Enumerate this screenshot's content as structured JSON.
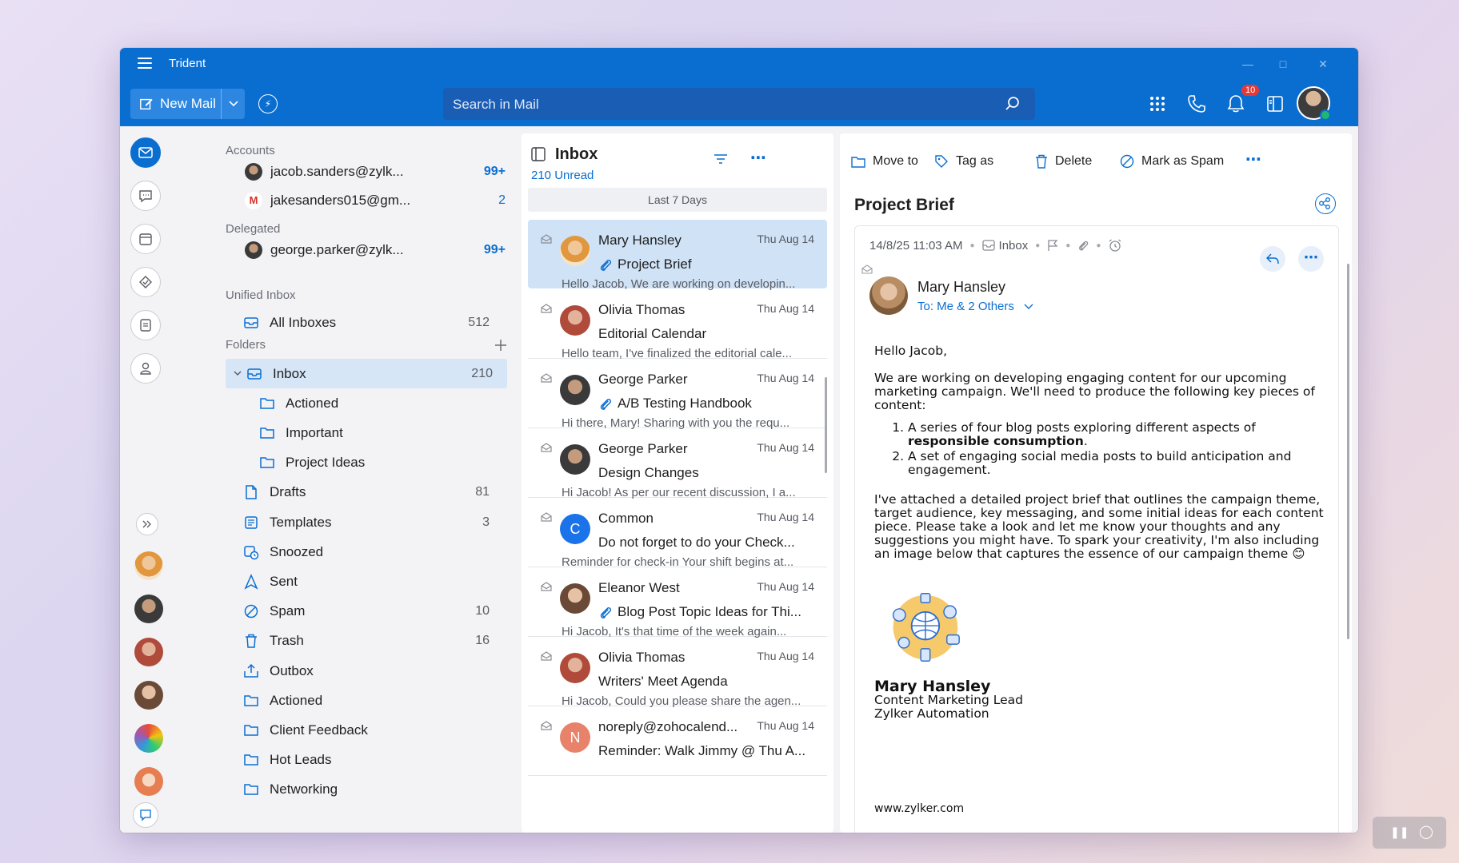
{
  "app": {
    "title": "Trident"
  },
  "toolbar": {
    "new_mail": "New Mail",
    "search_placeholder": "Search in Mail",
    "notification_count": "10"
  },
  "sidebar": {
    "accounts_label": "Accounts",
    "accounts": [
      {
        "name": "jacob.sanders@zylk...",
        "count": "99+"
      },
      {
        "name": "jakesanders015@gm...",
        "count": "2"
      }
    ],
    "delegated_label": "Delegated",
    "delegated": [
      {
        "name": "george.parker@zylk...",
        "count": "99+"
      }
    ],
    "unified_label": "Unified Inbox",
    "all_inboxes": {
      "name": "All Inboxes",
      "count": "512"
    },
    "folders_label": "Folders",
    "folders": [
      {
        "name": "Inbox",
        "count": "210"
      },
      {
        "name": "Actioned",
        "count": ""
      },
      {
        "name": "Important",
        "count": ""
      },
      {
        "name": "Project Ideas",
        "count": ""
      },
      {
        "name": "Drafts",
        "count": "81"
      },
      {
        "name": "Templates",
        "count": "3"
      },
      {
        "name": "Snoozed",
        "count": ""
      },
      {
        "name": "Sent",
        "count": ""
      },
      {
        "name": "Spam",
        "count": "10"
      },
      {
        "name": "Trash",
        "count": "16"
      },
      {
        "name": "Outbox",
        "count": ""
      },
      {
        "name": "Actioned",
        "count": ""
      },
      {
        "name": "Client Feedback",
        "count": ""
      },
      {
        "name": "Hot Leads",
        "count": ""
      },
      {
        "name": "Networking",
        "count": ""
      }
    ]
  },
  "list": {
    "title": "Inbox",
    "unread": "210 Unread",
    "range": "Last 7 Days",
    "mails": [
      {
        "from": "Mary Hansley",
        "date": "Thu Aug 14",
        "subject": "Project Brief",
        "preview": "Hello Jacob, We are working on developin...",
        "initial": ""
      },
      {
        "from": "Olivia Thomas",
        "date": "Thu Aug 14",
        "subject": "Editorial Calendar",
        "preview": "Hello team, I've finalized the editorial cale...",
        "initial": ""
      },
      {
        "from": "George Parker",
        "date": "Thu Aug 14",
        "subject": "A/B Testing Handbook",
        "preview": "Hi there, Mary! Sharing with you the requ...",
        "initial": ""
      },
      {
        "from": "George Parker",
        "date": "Thu Aug 14",
        "subject": "Design Changes",
        "preview": "Hi Jacob! As per our recent discussion, I a...",
        "initial": ""
      },
      {
        "from": "Common",
        "date": "Thu Aug 14",
        "subject": "Do not forget to do your Check...",
        "preview": "Reminder for check-in Your shift begins at...",
        "initial": "C"
      },
      {
        "from": "Eleanor West",
        "date": "Thu Aug 14",
        "subject": "Blog Post Topic Ideas for Thi...",
        "preview": "Hi Jacob, It's that time of the week again...",
        "initial": ""
      },
      {
        "from": "Olivia Thomas",
        "date": "Thu Aug 14",
        "subject": "Writers' Meet Agenda",
        "preview": "Hi Jacob, Could you please share the agen...",
        "initial": ""
      },
      {
        "from": "noreply@zohocalend...",
        "date": "Thu Aug 14",
        "subject": "Reminder: Walk Jimmy @ Thu A...",
        "preview": "",
        "initial": "N"
      }
    ]
  },
  "reader": {
    "actions": {
      "move": "Move to",
      "tag": "Tag as",
      "delete": "Delete",
      "spam": "Mark as Spam"
    },
    "subject": "Project Brief",
    "meta_date": "14/8/25 11:03 AM",
    "meta_folder": "Inbox",
    "sender": "Mary Hansley",
    "to": "To: Me & 2 Others",
    "greeting": "Hello Jacob,",
    "para1": "We are working on developing engaging content for our upcoming marketing campaign. We'll need to produce the following key pieces of content:",
    "item1_pre": "A series of four blog posts exploring different aspects of ",
    "item1_bold": "responsible consumption",
    "item1_post": ".",
    "item2": "A set of engaging social media posts to build anticipation and engagement.",
    "para2": "I've attached a detailed project brief that outlines the campaign theme, target audience, key messaging, and some initial ideas for each content piece. Please take a look and let me know your thoughts and any suggestions you might have. To spark your creativity, I'm also including an image below that captures the essence of our campaign theme",
    "emoji": "😊",
    "sig_name": "Mary Hansley",
    "sig_title": "Content Marketing Lead",
    "sig_company": "Zylker Automation",
    "website": "www.zylker.com"
  },
  "colors": {
    "accent": "#0a6ed1",
    "selected": "#cfe2f6"
  }
}
